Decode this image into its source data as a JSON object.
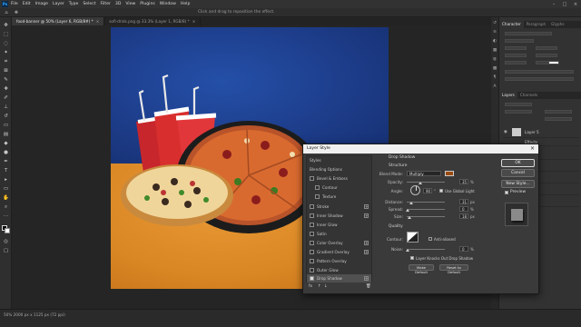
{
  "menubar": {
    "items": [
      "File",
      "Edit",
      "Image",
      "Layer",
      "Type",
      "Select",
      "Filter",
      "3D",
      "View",
      "Plugins",
      "Window",
      "Help"
    ]
  },
  "optionsbar": {
    "hint": "Click and drag to reposition the effect."
  },
  "tabs": [
    {
      "label": "food-banner @ 50% (Layer 6, RGB/8#) *",
      "active": true
    },
    {
      "label": "sofi-drink.png @ 33.3% (Layer 1, RGB/8) *",
      "active": false
    }
  ],
  "statusbar": {
    "text": "50%   2000 px x 1125 px (72 ppi)"
  },
  "panels": {
    "top_tabs": [
      "Character",
      "Paragraph",
      "Glyphs"
    ],
    "layer_tabs": [
      "Layers",
      "Channels"
    ],
    "layers": [
      {
        "name": "Layer 5"
      },
      {
        "name": "Effects"
      }
    ]
  },
  "dialog": {
    "title": "Layer Style",
    "styles_header": "Styles",
    "blending_options": "Blending Options",
    "style_items": [
      {
        "label": "Bevel & Emboss",
        "checked": false,
        "plus": false
      },
      {
        "label": "Contour",
        "checked": false,
        "plus": false
      },
      {
        "label": "Texture",
        "checked": false,
        "plus": false
      },
      {
        "label": "Stroke",
        "checked": false,
        "plus": true
      },
      {
        "label": "Inner Shadow",
        "checked": false,
        "plus": true
      },
      {
        "label": "Inner Glow",
        "checked": false,
        "plus": false
      },
      {
        "label": "Satin",
        "checked": false,
        "plus": false
      },
      {
        "label": "Color Overlay",
        "checked": false,
        "plus": true
      },
      {
        "label": "Gradient Overlay",
        "checked": false,
        "plus": true
      },
      {
        "label": "Pattern Overlay",
        "checked": false,
        "plus": false
      },
      {
        "label": "Outer Glow",
        "checked": false,
        "plus": false
      },
      {
        "label": "Drop Shadow",
        "checked": true,
        "plus": true,
        "selected": true
      }
    ],
    "section_title": "Drop Shadow",
    "structure_title": "Structure",
    "blend_mode_label": "Blend Mode:",
    "blend_mode_value": "Multiply",
    "shadow_color": "#9a4a0e",
    "opacity_label": "Opacity:",
    "opacity_value": "35",
    "angle_label": "Angle:",
    "angle_value": "90",
    "global_light_label": "Use Global Light",
    "distance_label": "Distance:",
    "distance_value": "31",
    "spread_label": "Spread:",
    "spread_value": "0",
    "size_label": "Size:",
    "size_value": "18",
    "quality_title": "Quality",
    "contour_label": "Contour:",
    "antialiased_label": "Anti-aliased",
    "noise_label": "Noise:",
    "noise_value": "0",
    "knockout_label": "Layer Knocks Out Drop Shadow",
    "make_default": "Make Default",
    "reset_default": "Reset to Default",
    "px": "px",
    "pct": "%",
    "deg": "°",
    "ok": "OK",
    "cancel": "Cancel",
    "new_style": "New Style...",
    "preview_label": "Preview",
    "footer_fx": "fx"
  }
}
